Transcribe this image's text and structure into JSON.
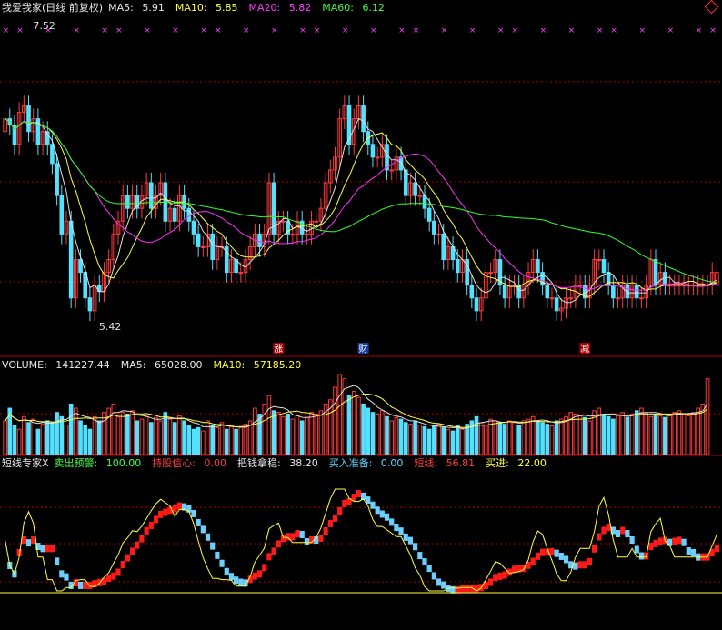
{
  "price_panel": {
    "title": "我爱我家(日线 前复权)",
    "ma5_label": "MA5:",
    "ma5_value": "5.91",
    "ma10_label": "MA10:",
    "ma10_value": "5.85",
    "ma20_label": "MA20:",
    "ma20_value": "5.82",
    "ma60_label": "MA60:",
    "ma60_value": "6.12",
    "high_marker": "7.52",
    "low_marker": "5.42",
    "event_labels": [
      "涨",
      "财",
      "减"
    ]
  },
  "volume_panel": {
    "vol_label": "VOLUME:",
    "vol_value": "141227.44",
    "ma5_label": "MA5:",
    "ma5_value": "65028.00",
    "ma10_label": "MA10:",
    "ma10_value": "57185.20"
  },
  "indicator_panel": {
    "name": "短线专家X",
    "sell_label": "卖出预警:",
    "sell_value": "100.00",
    "hold_label": "持股信心:",
    "hold_value": "0.00",
    "grip_label": "把钱拿稳:",
    "grip_value": "38.20",
    "buy_ready_label": "买入准备:",
    "buy_ready_value": "0.00",
    "short_label": "短线:",
    "short_value": "56.81",
    "buy_label": "买进:",
    "buy_value": "22.00"
  },
  "colors": {
    "up": "#ff3a3a",
    "down": "#54e1ff",
    "ma5": "#e0e0e0",
    "ma10": "#ffff40",
    "ma20": "#ff30ff",
    "ma60": "#30ff30",
    "grid": "#b00000"
  },
  "chart_data": {
    "type": "candlestick",
    "closes": [
      6.9,
      6.85,
      6.7,
      6.95,
      7.0,
      6.8,
      6.9,
      6.7,
      6.8,
      6.7,
      6.55,
      6.3,
      6.0,
      6.1,
      5.5,
      5.8,
      5.7,
      5.5,
      5.4,
      5.6,
      5.55,
      5.7,
      5.8,
      6.0,
      6.1,
      6.3,
      6.2,
      6.3,
      6.2,
      6.3,
      6.4,
      6.2,
      6.3,
      6.4,
      6.1,
      6.2,
      6.1,
      6.3,
      6.2,
      6.1,
      6.0,
      5.9,
      5.9,
      6.0,
      5.8,
      5.9,
      5.9,
      5.7,
      5.8,
      5.7,
      5.7,
      5.8,
      5.9,
      6.0,
      5.9,
      6.0,
      6.4,
      6.0,
      6.1,
      6.1,
      6.0,
      6.0,
      6.1,
      6.0,
      6.0,
      6.1,
      6.1,
      6.2,
      6.4,
      6.5,
      6.6,
      6.9,
      7.0,
      6.7,
      6.9,
      7.0,
      6.8,
      6.7,
      6.6,
      6.6,
      6.7,
      6.5,
      6.5,
      6.6,
      6.5,
      6.3,
      6.4,
      6.3,
      6.3,
      6.2,
      6.1,
      6.0,
      6.0,
      5.8,
      5.9,
      5.8,
      5.7,
      5.8,
      5.6,
      5.5,
      5.4,
      5.5,
      5.7,
      5.7,
      5.8,
      5.6,
      5.5,
      5.6,
      5.6,
      5.5,
      5.6,
      5.7,
      5.8,
      5.7,
      5.6,
      5.5,
      5.5,
      5.4,
      5.42,
      5.5,
      5.5,
      5.6,
      5.6,
      5.5,
      5.6,
      5.8,
      5.8,
      5.7,
      5.6,
      5.5,
      5.5,
      5.6,
      5.5,
      5.6,
      5.5,
      5.5,
      5.6,
      5.8,
      5.6,
      5.7,
      5.6,
      5.6,
      5.6,
      5.6,
      5.6,
      5.6,
      5.6,
      5.6,
      5.6,
      5.6,
      5.7,
      5.7
    ],
    "opens": [
      6.8,
      6.9,
      6.85,
      6.7,
      6.95,
      7.0,
      6.8,
      6.9,
      6.7,
      6.8,
      6.7,
      6.55,
      6.3,
      6.0,
      6.1,
      5.5,
      5.8,
      5.7,
      5.5,
      5.4,
      5.6,
      5.55,
      5.7,
      5.8,
      6.0,
      6.1,
      6.3,
      6.2,
      6.3,
      6.2,
      6.3,
      6.4,
      6.2,
      6.3,
      6.4,
      6.1,
      6.2,
      6.1,
      6.3,
      6.2,
      6.1,
      6.0,
      5.9,
      5.9,
      6.0,
      5.8,
      5.9,
      5.9,
      5.7,
      5.8,
      5.7,
      5.7,
      5.8,
      5.9,
      6.0,
      5.9,
      6.0,
      6.4,
      6.0,
      6.1,
      6.1,
      6.0,
      6.0,
      6.1,
      6.0,
      6.0,
      6.1,
      6.1,
      6.2,
      6.4,
      6.5,
      6.6,
      6.9,
      7.0,
      6.7,
      6.9,
      7.0,
      6.8,
      6.7,
      6.6,
      6.6,
      6.7,
      6.5,
      6.5,
      6.6,
      6.5,
      6.3,
      6.4,
      6.3,
      6.3,
      6.2,
      6.1,
      6.0,
      6.0,
      5.8,
      5.9,
      5.8,
      5.7,
      5.8,
      5.6,
      5.5,
      5.4,
      5.5,
      5.7,
      5.7,
      5.8,
      5.6,
      5.5,
      5.6,
      5.6,
      5.5,
      5.6,
      5.7,
      5.8,
      5.7,
      5.6,
      5.5,
      5.5,
      5.4,
      5.42,
      5.5,
      5.5,
      5.6,
      5.6,
      5.5,
      5.6,
      5.8,
      5.8,
      5.7,
      5.6,
      5.5,
      5.5,
      5.6,
      5.5,
      5.6,
      5.5,
      5.5,
      5.6,
      5.8,
      5.6,
      5.7,
      5.6,
      5.6,
      5.6,
      5.6,
      5.6,
      5.6,
      5.6,
      5.6,
      5.6,
      5.6,
      5.6
    ],
    "volumes": [
      40,
      55,
      35,
      30,
      45,
      38,
      42,
      30,
      36,
      40,
      38,
      50,
      45,
      35,
      60,
      55,
      40,
      35,
      30,
      45,
      40,
      50,
      55,
      60,
      45,
      50,
      48,
      52,
      40,
      42,
      45,
      38,
      44,
      40,
      50,
      42,
      38,
      46,
      40,
      35,
      30,
      32,
      28,
      40,
      35,
      32,
      38,
      30,
      34,
      30,
      32,
      36,
      40,
      55,
      48,
      60,
      70,
      52,
      50,
      45,
      48,
      42,
      46,
      40,
      44,
      50,
      48,
      52,
      60,
      65,
      80,
      95,
      90,
      70,
      75,
      68,
      60,
      55,
      50,
      48,
      52,
      45,
      40,
      44,
      42,
      38,
      36,
      40,
      35,
      33,
      30,
      34,
      36,
      32,
      30,
      28,
      34,
      30,
      36,
      40,
      45,
      38,
      35,
      42,
      40,
      38,
      36,
      40,
      38,
      35,
      40,
      42,
      45,
      40,
      38,
      36,
      34,
      40,
      42,
      45,
      50,
      48,
      46,
      44,
      40,
      52,
      55,
      48,
      45,
      42,
      46,
      50,
      44,
      48,
      52,
      55,
      50,
      45,
      48,
      46,
      44,
      48,
      50,
      52,
      48,
      46,
      50,
      55,
      60,
      90
    ]
  }
}
